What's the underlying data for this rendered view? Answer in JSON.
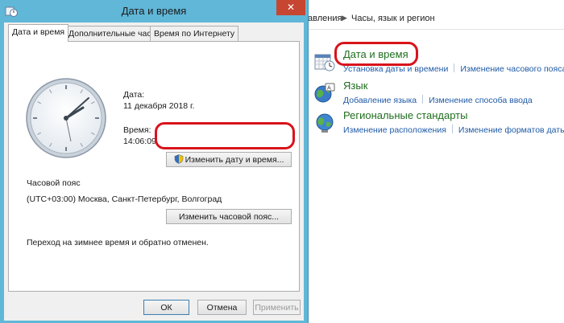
{
  "dialog": {
    "title": "Дата и время",
    "close_glyph": "✕",
    "tabs": [
      {
        "label": "Дата и время",
        "active": true
      },
      {
        "label": "Дополнительные часы",
        "active": false
      },
      {
        "label": "Время по Интернету",
        "active": false
      }
    ],
    "date_label": "Дата:",
    "date_value": "11 декабря 2018 г.",
    "time_label": "Время:",
    "time_value": "14:06:09",
    "change_datetime_button": "Изменить дату и время...",
    "timezone_label": "Часовой пояс",
    "timezone_value": "(UTC+03:00) Москва, Санкт-Петербург, Волгоград",
    "change_timezone_button": "Изменить часовой пояс...",
    "dst_note": "Переход на зимнее время и обратно отменен.",
    "ok_button": "ОК",
    "cancel_button": "Отмена",
    "apply_button": "Применить"
  },
  "control_panel": {
    "breadcrumb_prefix": "авления",
    "breadcrumb_current": "Часы, язык и регион",
    "categories": [
      {
        "icon": "calendar-clock-icon",
        "title": "Дата и время",
        "links": [
          "Установка даты и времени",
          "Изменение часового пояса"
        ]
      },
      {
        "icon": "language-globe-icon",
        "title": "Язык",
        "links": [
          "Добавление языка",
          "Изменение способа ввода"
        ]
      },
      {
        "icon": "region-globe-icon",
        "title": "Региональные стандарты",
        "links": [
          "Изменение расположения",
          "Изменение форматов даты,"
        ]
      }
    ]
  },
  "colors": {
    "title_bar": "#60b7d8",
    "close_button": "#c74632",
    "highlight_oval": "#d9131b",
    "category_title": "#1f6e1f",
    "link": "#1f5aa6"
  }
}
